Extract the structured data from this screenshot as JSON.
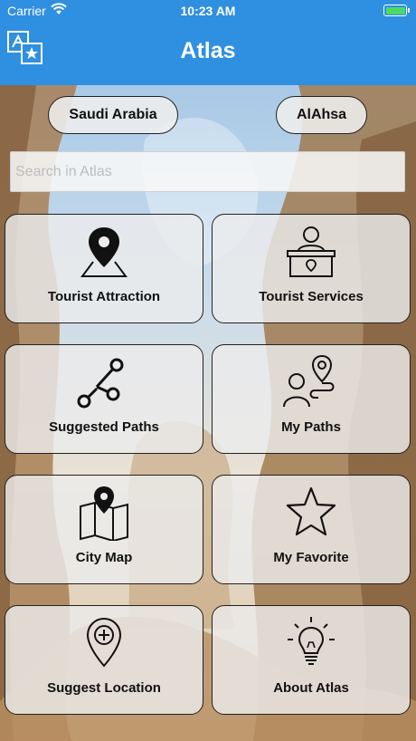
{
  "status_bar": {
    "carrier": "Carrier",
    "time": "10:23 AM"
  },
  "nav": {
    "title": "Atlas",
    "translate_icon": "translate-icon"
  },
  "location": {
    "country": "Saudi Arabia",
    "city": "AlAhsa"
  },
  "search": {
    "placeholder": "Search in Atlas"
  },
  "menu": [
    {
      "label": "Tourist Attraction",
      "icon": "map-pin-icon"
    },
    {
      "label": "Tourist Services",
      "icon": "reception-desk-icon"
    },
    {
      "label": "Suggested Paths",
      "icon": "share-nodes-icon"
    },
    {
      "label": "My Paths",
      "icon": "person-path-icon"
    },
    {
      "label": "City Map",
      "icon": "folded-map-icon"
    },
    {
      "label": "My Favorite",
      "icon": "star-icon"
    },
    {
      "label": "Suggest Location",
      "icon": "add-location-icon"
    },
    {
      "label": "About Atlas",
      "icon": "lightbulb-icon"
    }
  ],
  "colors": {
    "nav_bar": "#2f8fe0",
    "battery": "#4cd964"
  }
}
